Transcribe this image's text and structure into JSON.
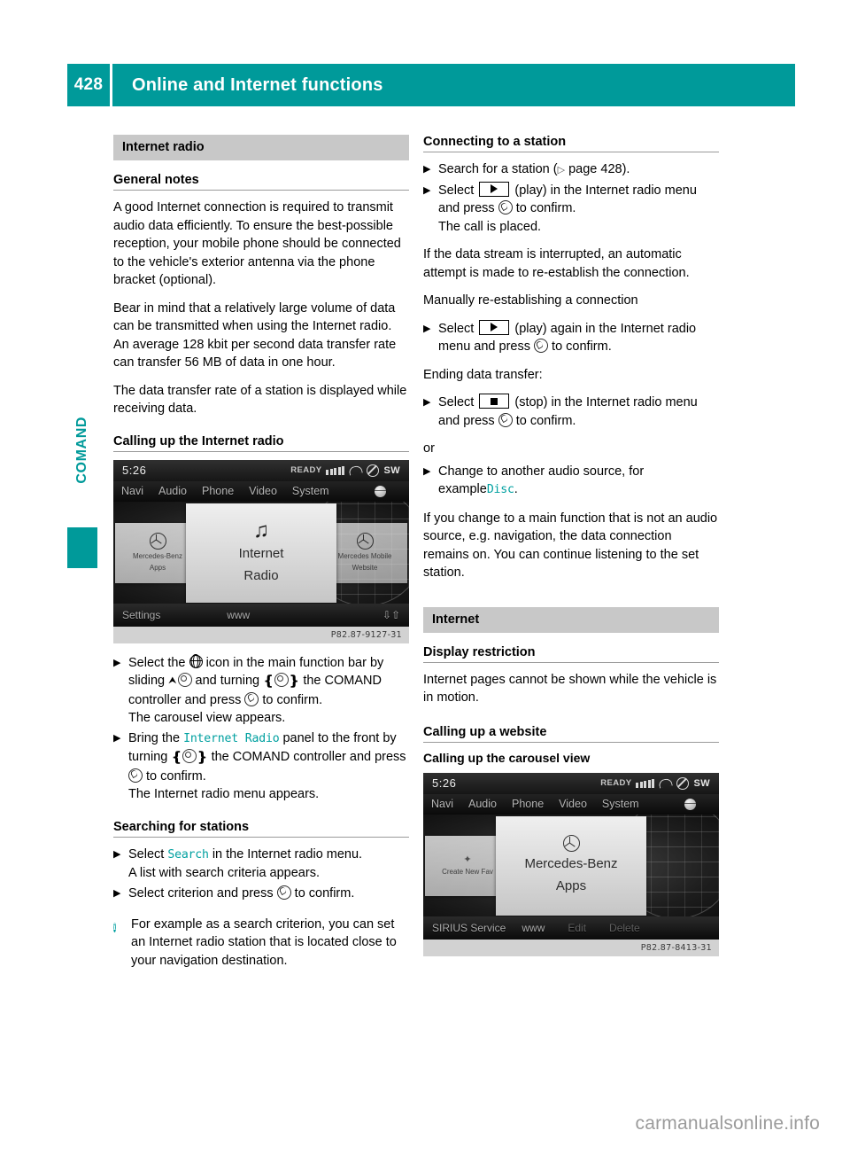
{
  "header": {
    "page_number": "428",
    "title": "Online and Internet functions",
    "accent_color": "#009a9a"
  },
  "side_tab": {
    "label": "COMAND"
  },
  "left_column": {
    "section_band": "Internet radio",
    "general_notes": {
      "heading": "General notes",
      "paragraphs": [
        "A good Internet connection is required to transmit audio data efficiently. To ensure the best-possible reception, your mobile phone should be connected to the vehicle's exterior antenna via the phone bracket (optional).",
        "Bear in mind that a relatively large volume of data can be transmitted when using the Internet radio. An average 128 kbit per second data transfer rate can transfer 56 MB of data in one hour.",
        "The data transfer rate of a station is displayed while receiving data."
      ]
    },
    "calling_up": {
      "heading": "Calling up the Internet radio",
      "step1_a": "Select the",
      "step1_b": "icon in the main function bar by sliding",
      "step1_c": "and turning",
      "step1_d": "the COMAND controller and press",
      "step1_e": "to confirm.",
      "step1_result": "The carousel view appears.",
      "step2_a": "Bring the",
      "step2_ui": "Internet Radio",
      "step2_b": "panel to the front by turning",
      "step2_c": "the COMAND controller and press",
      "step2_d": "to confirm.",
      "step2_result": "The Internet radio menu appears."
    },
    "searching": {
      "heading": "Searching for stations",
      "step1_a": "Select",
      "step1_ui": "Search",
      "step1_b": "in the Internet radio menu.",
      "step1_result": "A list with search criteria appears.",
      "step2_a": "Select criterion and press",
      "step2_b": "to confirm.",
      "note_icon": "i",
      "note": "For example as a search criterion, you can set an Internet radio station that is located close to your navigation destination."
    },
    "comand_screen": {
      "clock": "5:26",
      "ready_label": "READY",
      "sw_label": "SW",
      "menu_items": [
        "Navi",
        "Audio",
        "Phone",
        "Video",
        "System"
      ],
      "tile_left_line1": "Mercedes-Benz",
      "tile_left_line2": "Apps",
      "tile_front_line1": "Internet",
      "tile_front_line2": "Radio",
      "tile_right_line1": "Mercedes Mobile",
      "tile_right_line2": "Website",
      "bottom_left": "Settings",
      "bottom_mid": "www",
      "caption_code": "P82.87-9127-31"
    }
  },
  "right_column": {
    "connecting": {
      "heading": "Connecting to a station",
      "step1_a": "Search for a station (",
      "step1_pageref": "page 428).",
      "step2_a": "Select",
      "step2_b": "(play) in the Internet radio menu and press",
      "step2_c": "to confirm.",
      "step2_result": "The call is placed.",
      "para1": "If the data stream is interrupted, an automatic attempt is made to re-establish the connection.",
      "para2": "Manually re-establishing a connection",
      "step3_a": "Select",
      "step3_b": "(play) again in the Internet radio menu and press",
      "step3_c": "to confirm.",
      "para3": "Ending data transfer:",
      "step4_a": "Select",
      "step4_b": "(stop) in the Internet radio menu and press",
      "step4_c": "to confirm.",
      "or_label": "or",
      "step5_a": "Change to another audio source, for example",
      "step5_ui": "Disc",
      "step5_b": ".",
      "para4": "If you change to a main function that is not an audio source, e.g. navigation, the data connection remains on. You can continue listening to the set station."
    },
    "internet": {
      "section_band": "Internet",
      "display_restriction_heading": "Display restriction",
      "display_restriction_text": "Internet pages cannot be shown while the vehicle is in motion.",
      "calling_up_website_heading": "Calling up a website",
      "carousel_heading": "Calling up the carousel view"
    },
    "comand_screen": {
      "clock": "5:26",
      "ready_label": "READY",
      "sw_label": "SW",
      "menu_items": [
        "Navi",
        "Audio",
        "Phone",
        "Video",
        "System"
      ],
      "tile_left_line1": "Create New Fav",
      "tile_front_line1": "Mercedes-Benz",
      "tile_front_line2": "Apps",
      "bottom_item1": "SIRIUS Service",
      "bottom_item2": "www",
      "bottom_item3": "Edit",
      "bottom_item4": "Delete",
      "caption_code": "P82.87-8413-31"
    }
  },
  "footer": {
    "watermark": "carmanualsonline.info"
  }
}
